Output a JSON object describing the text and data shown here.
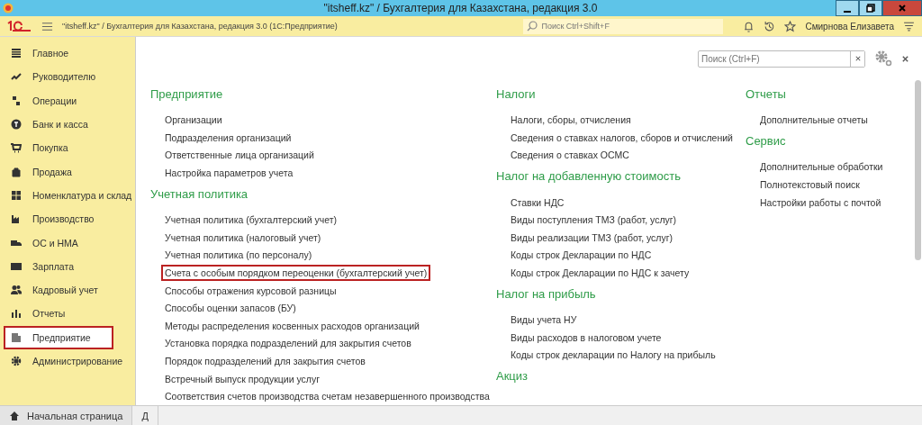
{
  "window": {
    "title": "\"itsheff.kz\" / Бухгалтерия для Казахстана, редакция 3.0"
  },
  "toolbar": {
    "app_title": "\"itsheff.kz\" / Бухгалтерия для Казахстана, редакция 3.0  (1С:Предприятие)",
    "search": {
      "placeholder": "Поиск Ctrl+Shift+F"
    },
    "user": "Смирнова Елизавета"
  },
  "sidebar": {
    "items": [
      {
        "label": "Главное",
        "selected": false
      },
      {
        "label": "Руководителю",
        "selected": false
      },
      {
        "label": "Операции",
        "selected": false
      },
      {
        "label": "Банк и касса",
        "selected": false
      },
      {
        "label": "Покупка",
        "selected": false
      },
      {
        "label": "Продажа",
        "selected": false
      },
      {
        "label": "Номенклатура и склад",
        "selected": false
      },
      {
        "label": "Производство",
        "selected": false
      },
      {
        "label": "ОС и НМА",
        "selected": false
      },
      {
        "label": "Зарплата",
        "selected": false
      },
      {
        "label": "Кадровый учет",
        "selected": false
      },
      {
        "label": "Отчеты",
        "selected": false
      },
      {
        "label": "Предприятие",
        "selected": true
      },
      {
        "label": "Администрирование",
        "selected": false
      }
    ]
  },
  "panel": {
    "search": {
      "placeholder": "Поиск (Ctrl+F)"
    },
    "columns": [
      [
        {
          "heading": "Предприятие",
          "items": [
            {
              "label": "Организации",
              "highlighted": false
            },
            {
              "label": "Подразделения организаций",
              "highlighted": false
            },
            {
              "label": "Ответственные лица организаций",
              "highlighted": false
            },
            {
              "label": "Настройка параметров учета",
              "highlighted": false
            }
          ]
        },
        {
          "heading": "Учетная политика",
          "items": [
            {
              "label": "Учетная политика (бухгалтерский учет)",
              "highlighted": false
            },
            {
              "label": "Учетная политика (налоговый учет)",
              "highlighted": false
            },
            {
              "label": "Учетная политика (по персоналу)",
              "highlighted": false
            },
            {
              "label": "Счета с особым порядком переоценки (бухгалтерский учет)",
              "highlighted": true
            },
            {
              "label": "Способы отражения курсовой разницы",
              "highlighted": false
            },
            {
              "label": "Способы оценки запасов (БУ)",
              "highlighted": false
            },
            {
              "label": "Методы распределения косвенных расходов организаций",
              "highlighted": false
            },
            {
              "label": "Установка порядка подразделений для закрытия счетов",
              "highlighted": false
            },
            {
              "label": "Порядок подразделений для закрытия счетов",
              "highlighted": false
            },
            {
              "label": "Встречный выпуск продукции услуг",
              "highlighted": false
            },
            {
              "label": "Соответствия счетов производства счетам незавершенного производства",
              "highlighted": false
            }
          ]
        }
      ],
      [
        {
          "heading": "Налоги",
          "items": [
            {
              "label": "Налоги, сборы, отчисления",
              "highlighted": false
            },
            {
              "label": "Сведения о ставках налогов, сборов и отчислений",
              "highlighted": false
            },
            {
              "label": "Сведения о ставках ОСМС",
              "highlighted": false
            }
          ]
        },
        {
          "heading": "Налог на добавленную стоимость",
          "items": [
            {
              "label": "Ставки НДС",
              "highlighted": false
            },
            {
              "label": "Виды поступления ТМЗ (работ, услуг)",
              "highlighted": false
            },
            {
              "label": "Виды реализации ТМЗ (работ, услуг)",
              "highlighted": false
            },
            {
              "label": "Коды строк Декларации по НДС",
              "highlighted": false
            },
            {
              "label": "Коды строк Декларации по НДС к зачету",
              "highlighted": false
            }
          ]
        },
        {
          "heading": "Налог на прибыль",
          "items": [
            {
              "label": "Виды учета НУ",
              "highlighted": false
            },
            {
              "label": "Виды расходов в налоговом учете",
              "highlighted": false
            },
            {
              "label": "Коды строк декларации по Налогу на прибыль",
              "highlighted": false
            }
          ]
        },
        {
          "heading": "Акциз"
        }
      ],
      [
        {
          "heading": "Отчеты",
          "items": [
            {
              "label": "Дополнительные отчеты",
              "highlighted": false
            }
          ]
        },
        {
          "heading": "Сервис",
          "items": [
            {
              "label": "Дополнительные обработки",
              "highlighted": false
            },
            {
              "label": "Полнотекстовый поиск",
              "highlighted": false
            },
            {
              "label": "Настройки работы с почтой",
              "highlighted": false
            }
          ]
        }
      ]
    ]
  },
  "taskbar": {
    "tabs": [
      {
        "label": "Начальная страница",
        "selected": true
      },
      {
        "label": "Д",
        "selected": false
      }
    ]
  }
}
